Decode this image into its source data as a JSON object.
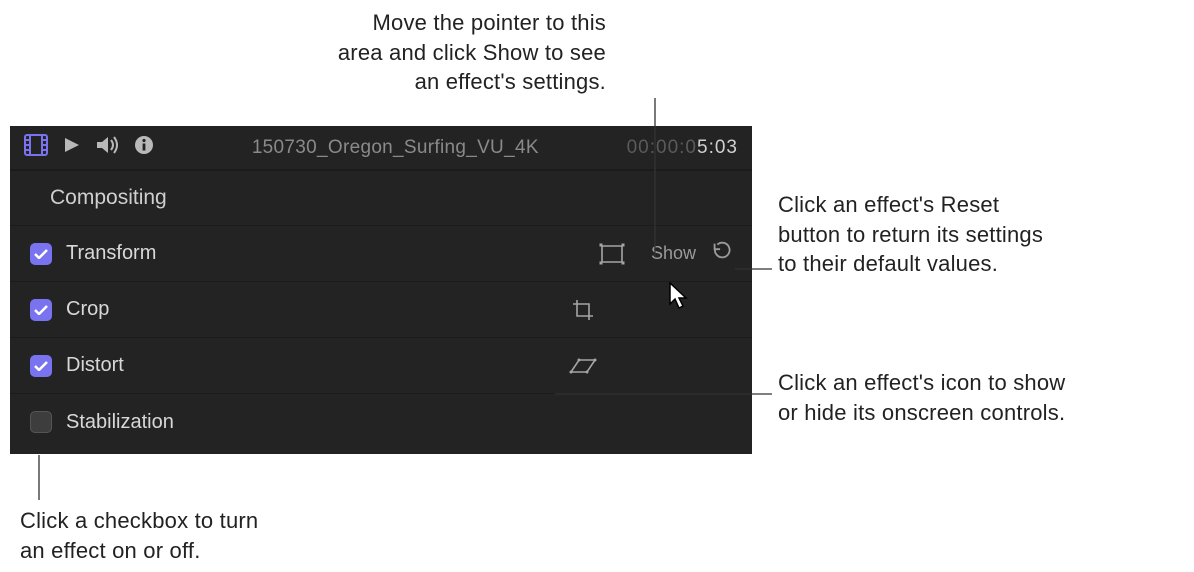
{
  "callouts": {
    "top": {
      "l1": "Move the pointer to this",
      "l2": "area and click Show to see",
      "l3": "an effect's settings."
    },
    "reset": {
      "l1": "Click an effect's Reset",
      "l2": "button to return its settings",
      "l3": "to their default values."
    },
    "icon": {
      "l1": "Click an effect's icon to show",
      "l2": "or hide its onscreen controls."
    },
    "checkbox": {
      "l1": "Click a checkbox to turn",
      "l2": "an effect on or off."
    }
  },
  "panel": {
    "clip_name": "150730_Oregon_Surfing_VU_4K",
    "timecode_dim": "00:00:0",
    "timecode_bright": "5:03",
    "section_compositing": "Compositing",
    "show_label": "Show",
    "rows": {
      "transform": "Transform",
      "crop": "Crop",
      "distort": "Distort",
      "stabilization": "Stabilization"
    }
  }
}
